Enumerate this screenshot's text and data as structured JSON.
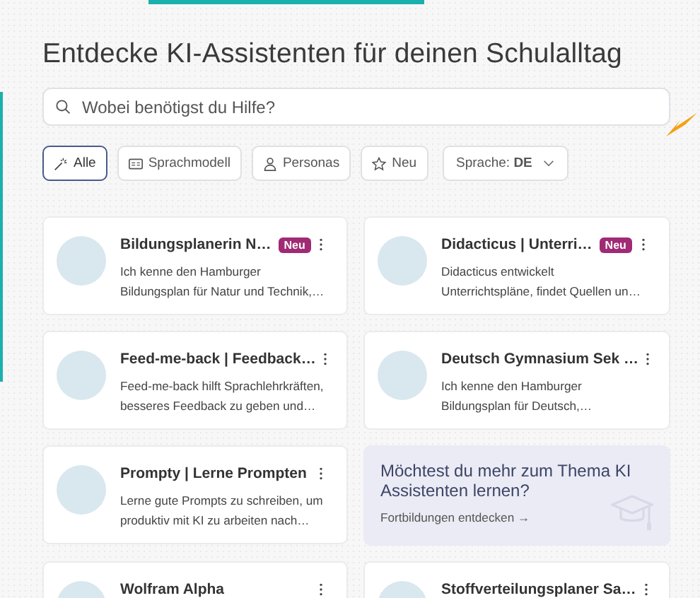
{
  "title": "Entdecke KI-Assistenten für deinen Schulalltag",
  "search": {
    "placeholder": "Wobei benötigst du Hilfe?"
  },
  "filters": [
    {
      "kind": "chip",
      "label": "Alle",
      "selected": true
    },
    {
      "kind": "chip",
      "label": "Sprachmodell",
      "selected": false
    },
    {
      "kind": "chip",
      "label": "Personas",
      "selected": false
    },
    {
      "kind": "chip",
      "label": "Neu",
      "selected": false
    },
    {
      "kind": "dropdown",
      "label": "Sprache: **DE**"
    }
  ],
  "cards": [
    {
      "kind": "assistant",
      "title": "Bildungsplanerin N…",
      "badge": "Neu",
      "description": "Ich kenne den Hamburger Bildungsplan für Natur und Technik,…"
    },
    {
      "kind": "assistant",
      "title": "Didacticus | Unterri…",
      "badge": "Neu",
      "description": "Didacticus entwickelt Unterrichtspläne, findet Quellen un…"
    },
    {
      "kind": "assistant",
      "title": "Feed-me-back | Feedback…",
      "description": "Feed-me-back hilft Sprachlehrkräften, besseres Feedback zu geben und…"
    },
    {
      "kind": "assistant",
      "title": "Deutsch Gymnasium Sek …",
      "description": "Ich kenne den Hamburger Bildungsplan für Deutsch,…"
    },
    {
      "kind": "assistant",
      "title": "Prompty | Lerne Prompten",
      "description": "Lerne gute Prompts zu schreiben, um produktiv mit KI zu arbeiten nach…"
    },
    {
      "kind": "promo",
      "title": "Möchtest du mehr zum Thema KI Assistenten lernen?",
      "link": "Fortbildungen entdecken →"
    },
    {
      "kind": "assistant",
      "title": "Wolfram Alpha"
    },
    {
      "kind": "assistant",
      "title": "Stoffverteilungsplaner Sa…"
    }
  ]
}
